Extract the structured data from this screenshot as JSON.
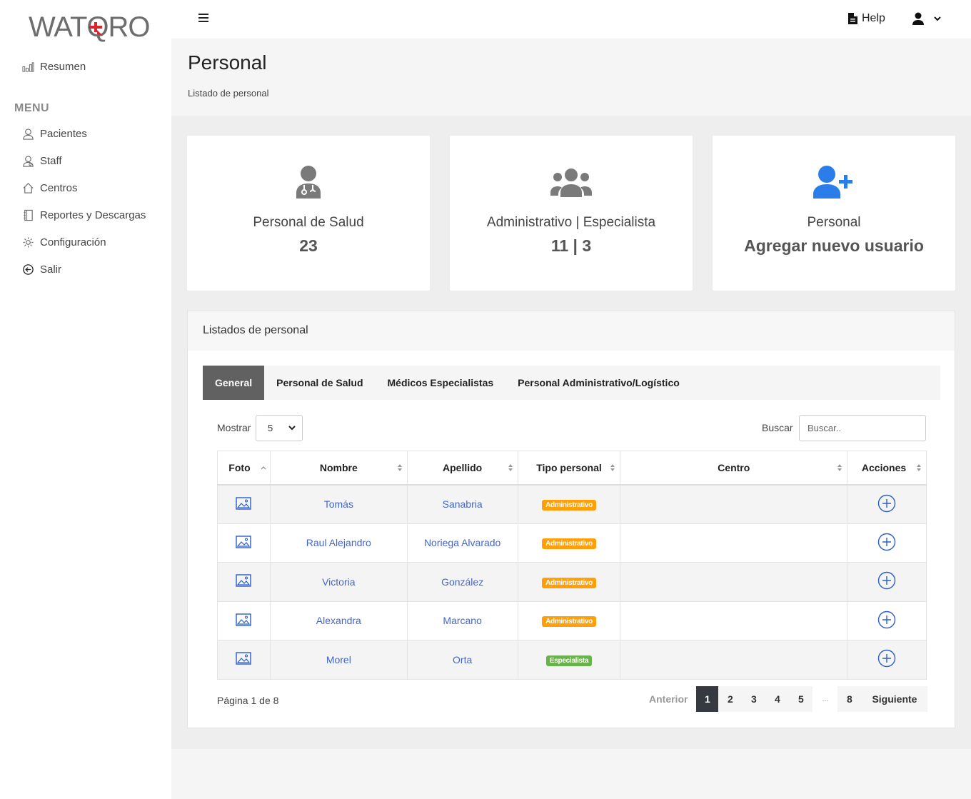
{
  "brand": {
    "logo_text": "WATQRO",
    "accent": "#d9262e"
  },
  "sidebar": {
    "summary_label": "Resumen",
    "menu_heading": "MENU",
    "items": [
      {
        "label": "Pacientes",
        "icon": "user-icon"
      },
      {
        "label": "Staff",
        "icon": "staff-icon"
      },
      {
        "label": "Centros",
        "icon": "home-icon"
      },
      {
        "label": "Reportes y Descargas",
        "icon": "notebook-icon"
      },
      {
        "label": "Configuración",
        "icon": "gear-icon"
      },
      {
        "label": "Salir",
        "icon": "logout-icon"
      }
    ]
  },
  "topbar": {
    "help_label": "Help"
  },
  "page": {
    "title": "Personal",
    "subtitle": "Listado de personal"
  },
  "cards": [
    {
      "label": "Personal de Salud",
      "value": "23",
      "icon": "doctor-icon"
    },
    {
      "label": "Administrativo | Especialista",
      "value": "11 | 3",
      "icon": "users-group-icon"
    },
    {
      "label": "Personal",
      "value": "Agregar nuevo usuario",
      "icon": "user-plus-icon"
    }
  ],
  "panel": {
    "title": "Listados de personal",
    "tabs": [
      "General",
      "Personal de Salud",
      "Médicos Especialistas",
      "Personal Administrativo/Logístico"
    ],
    "show_label": "Mostrar",
    "show_value": "5",
    "search_label": "Buscar",
    "search_placeholder": "Buscar..",
    "columns": [
      "Foto",
      "Nombre",
      "Apellido",
      "Tipo personal",
      "Centro",
      "Acciones"
    ],
    "rows": [
      {
        "nombre": "Tomás",
        "apellido": "Sanabria",
        "tipo": "Administrativo",
        "centro": ""
      },
      {
        "nombre": "Raul Alejandro",
        "apellido": "Noriega Alvarado",
        "tipo": "Administrativo",
        "centro": ""
      },
      {
        "nombre": "Victoria",
        "apellido": "González",
        "tipo": "Administrativo",
        "centro": ""
      },
      {
        "nombre": "Alexandra",
        "apellido": "Marcano",
        "tipo": "Administrativo",
        "centro": ""
      },
      {
        "nombre": "Morel",
        "apellido": "Orta",
        "tipo": "Especialista",
        "centro": ""
      }
    ],
    "page_info": "Página 1 de 8",
    "pagination": {
      "prev": "Anterior",
      "pages": [
        "1",
        "2",
        "3",
        "4",
        "5"
      ],
      "ellipsis": "...",
      "last": "8",
      "next": "Siguiente"
    }
  },
  "colors": {
    "link": "#4466cc",
    "badge_admin": "#ff9f0a",
    "badge_esp": "#6ab34c",
    "accent_blue": "#2b7de9"
  }
}
